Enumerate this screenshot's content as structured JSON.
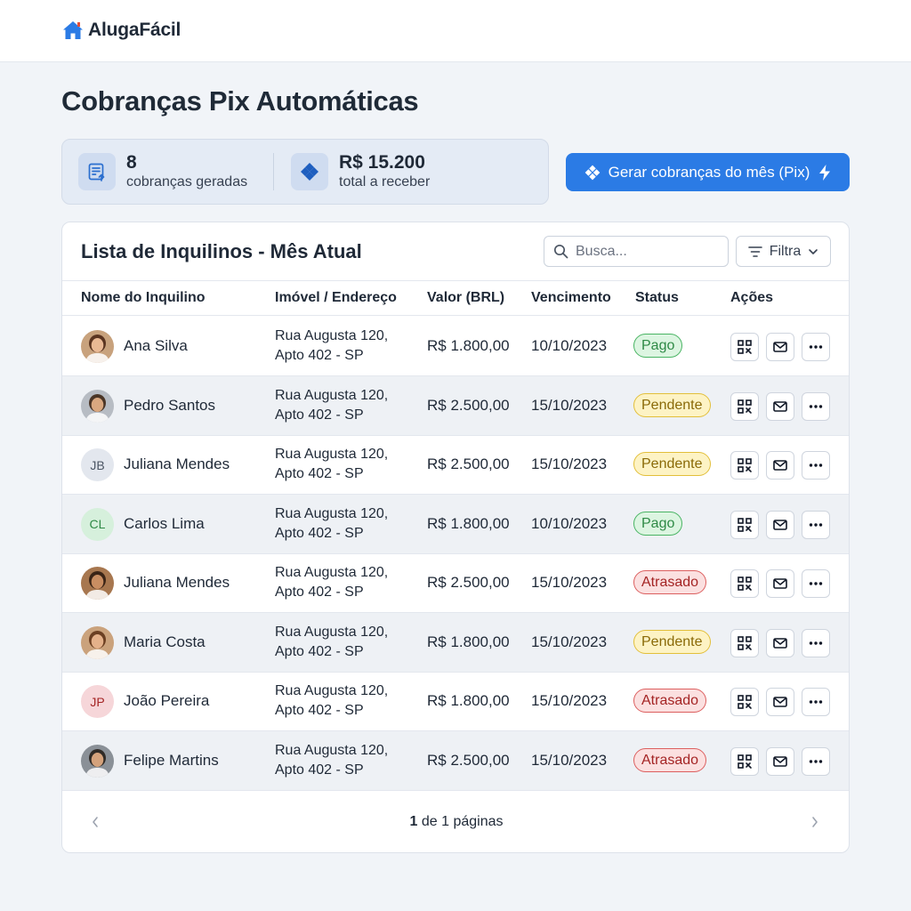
{
  "app": {
    "name": "AlugaFácil"
  },
  "page": {
    "title": "Cobranças Pix Automáticas"
  },
  "stats": [
    {
      "value": "8",
      "label": "cobranças geradas"
    },
    {
      "value": "R$ 15.200",
      "label": "total a receber"
    }
  ],
  "generate_button": {
    "label": "Gerar cobranças do mês (Pix)"
  },
  "table_card": {
    "title": "Lista de Inquilinos - Mês Atual",
    "search_placeholder": "Busca...",
    "filter_label": "Filtra",
    "columns": [
      "Nome do Inquilino",
      "Imóvel / Endereço",
      "Valor (BRL)",
      "Vencimento",
      "Status",
      "Ações"
    ]
  },
  "rows": [
    {
      "name": "Ana Silva",
      "initials": "",
      "addr1": "Rua Augusta 120,",
      "addr2": "Apto 402 - SP",
      "value": "R$ 1.800,00",
      "due": "10/10/2023",
      "status": "Pago"
    },
    {
      "name": "Pedro Santos",
      "initials": "",
      "addr1": "Rua Augusta 120,",
      "addr2": "Apto 402 - SP",
      "value": "R$ 2.500,00",
      "due": "15/10/2023",
      "status": "Pendente"
    },
    {
      "name": "Juliana Mendes",
      "initials": "JB",
      "addr1": "Rua Augusta 120,",
      "addr2": "Apto 402 - SP",
      "value": "R$ 2.500,00",
      "due": "15/10/2023",
      "status": "Pendente"
    },
    {
      "name": "Carlos Lima",
      "initials": "CL",
      "addr1": "Rua Augusta 120,",
      "addr2": "Apto 402 - SP",
      "value": "R$ 1.800,00",
      "due": "10/10/2023",
      "status": "Pago"
    },
    {
      "name": "Juliana Mendes",
      "initials": "",
      "addr1": "Rua Augusta 120,",
      "addr2": "Apto 402 - SP",
      "value": "R$ 2.500,00",
      "due": "15/10/2023",
      "status": "Atrasado"
    },
    {
      "name": "Maria Costa",
      "initials": "",
      "addr1": "Rua Augusta 120,",
      "addr2": "Apto 402 - SP",
      "value": "R$ 1.800,00",
      "due": "15/10/2023",
      "status": "Pendente"
    },
    {
      "name": "João Pereira",
      "initials": "JP",
      "addr1": "Rua Augusta 120,",
      "addr2": "Apto 402 - SP",
      "value": "R$ 1.800,00",
      "due": "15/10/2023",
      "status": "Atrasado"
    },
    {
      "name": "Felipe Martins",
      "initials": "",
      "addr1": "Rua Augusta 120,",
      "addr2": "Apto 402 - SP",
      "value": "R$ 2.500,00",
      "due": "15/10/2023",
      "status": "Atrasado"
    }
  ],
  "pagination": {
    "current": "1",
    "text": "de 1 páginas"
  },
  "icons": {
    "brand": "house-icon",
    "stat1": "invoice-icon",
    "stat2": "pix-icon",
    "actions": [
      "qr-code-icon",
      "mail-icon",
      "more-icon"
    ]
  },
  "colors": {
    "accent": "#2b7be5",
    "pago": "#2f8a46",
    "pendente": "#8a6a08",
    "atrasado": "#a42424"
  }
}
